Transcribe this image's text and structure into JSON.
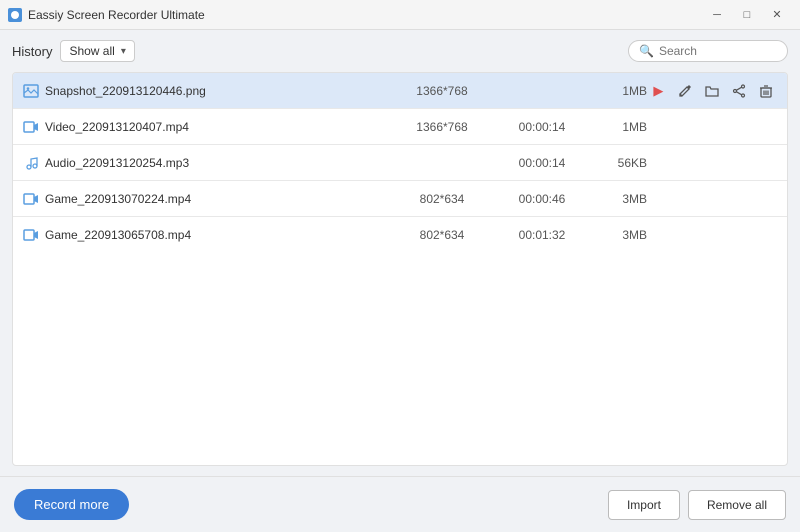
{
  "titleBar": {
    "title": "Eassiy Screen Recorder Ultimate",
    "minBtn": "─",
    "maxBtn": "□",
    "closeBtn": "✕"
  },
  "toolbar": {
    "historyLabel": "History",
    "dropdownValue": "Show all",
    "search": {
      "placeholder": "Search"
    }
  },
  "table": {
    "rows": [
      {
        "id": 1,
        "name": "Snapshot_220913120446.png",
        "type": "image",
        "resolution": "1366*768",
        "duration": "",
        "size": "1MB",
        "selected": true
      },
      {
        "id": 2,
        "name": "Video_220913120407.mp4",
        "type": "video",
        "resolution": "1366*768",
        "duration": "00:00:14",
        "size": "1MB",
        "selected": false
      },
      {
        "id": 3,
        "name": "Audio_220913120254.mp3",
        "type": "audio",
        "resolution": "",
        "duration": "00:00:14",
        "size": "56KB",
        "selected": false
      },
      {
        "id": 4,
        "name": "Game_220913070224.mp4",
        "type": "video",
        "resolution": "802*634",
        "duration": "00:00:46",
        "size": "3MB",
        "selected": false
      },
      {
        "id": 5,
        "name": "Game_220913065708.mp4",
        "type": "video",
        "resolution": "802*634",
        "duration": "00:01:32",
        "size": "3MB",
        "selected": false
      }
    ]
  },
  "actions": {
    "play": "▶",
    "edit": "✏",
    "folder": "📁",
    "share": "⇪",
    "delete": "🗑"
  },
  "bottomBar": {
    "recordMore": "Record more",
    "import": "Import",
    "removeAll": "Remove all"
  }
}
